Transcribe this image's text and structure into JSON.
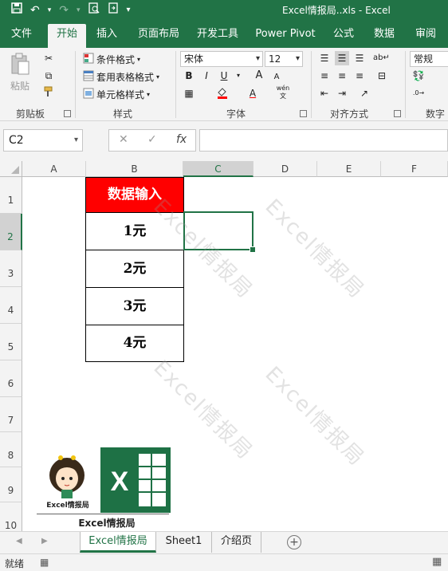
{
  "window": {
    "title": "Excel情报局..xls  -  Excel"
  },
  "qat": {
    "save": "save-icon",
    "undo": "undo-icon",
    "redo": "redo-icon",
    "preview": "print-preview-icon",
    "export": "export-icon",
    "more": "▾"
  },
  "tabs": [
    "文件",
    "开始",
    "插入",
    "页面布局",
    "开发工具",
    "Power Pivot",
    "公式",
    "数据",
    "审阅"
  ],
  "active_tab": "开始",
  "ribbon": {
    "clipboard": {
      "paste": "粘贴",
      "label": "剪贴板"
    },
    "styles": {
      "conditional": "条件格式",
      "table": "套用表格格式",
      "cell": "单元格样式",
      "label": "样式"
    },
    "font": {
      "name": "宋体",
      "size": "12",
      "bold": "B",
      "italic": "I",
      "underline": "U",
      "grow": "A",
      "shrink": "A",
      "label": "字体",
      "phonetic": "wén"
    },
    "alignment": {
      "label": "对齐方式"
    },
    "number": {
      "format": "常规",
      "label": "数字"
    }
  },
  "formula_bar": {
    "namebox": "C2",
    "fx": "fx",
    "cancel": "✕",
    "enter": "✓",
    "content": ""
  },
  "columns": [
    "A",
    "B",
    "C",
    "D",
    "E",
    "F"
  ],
  "rows": [
    "1",
    "2",
    "3",
    "4",
    "5",
    "6",
    "7",
    "8",
    "9",
    "10"
  ],
  "selected_cell": "C2",
  "table": {
    "header": "数据输入",
    "values": [
      "1元",
      "2元",
      "3元",
      "4元"
    ]
  },
  "watermark": "Excel情报局",
  "logo": {
    "caption": "Excel情报局",
    "bottom": "Excel情报局",
    "letter": "X"
  },
  "sheets": [
    "Excel情报局",
    "Sheet1",
    "介绍页"
  ],
  "active_sheet": "Excel情报局",
  "status": "就绪",
  "colors": {
    "accent": "#217346",
    "header_fill": "#ff0000"
  }
}
